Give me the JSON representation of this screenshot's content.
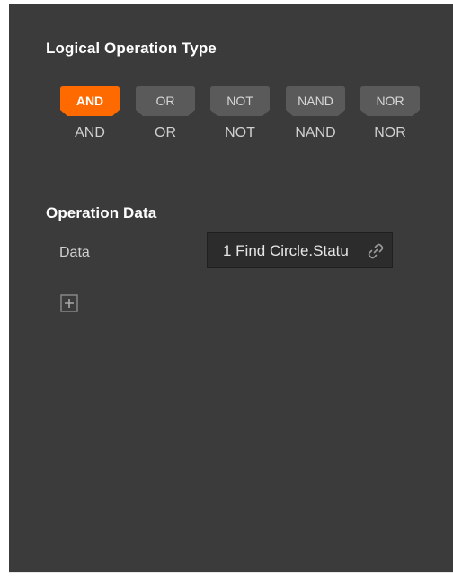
{
  "logical_operation_type": {
    "title": "Logical Operation Type",
    "selected": "AND",
    "operations": [
      {
        "badge": "AND",
        "caption": "AND"
      },
      {
        "badge": "OR",
        "caption": "OR"
      },
      {
        "badge": "NOT",
        "caption": "NOT"
      },
      {
        "badge": "NAND",
        "caption": "NAND"
      },
      {
        "badge": "NOR",
        "caption": "NOR"
      }
    ]
  },
  "operation_data": {
    "title": "Operation Data",
    "row_label": "Data",
    "field_value": "1 Find Circle.Statu",
    "link_icon": "link-icon",
    "add_icon": "plus-square-icon"
  },
  "colors": {
    "panel_background": "#3b3b3b",
    "active_badge": "#ff6a00",
    "inactive_badge": "#5a5a5a",
    "field_background": "#2c2c2c"
  }
}
